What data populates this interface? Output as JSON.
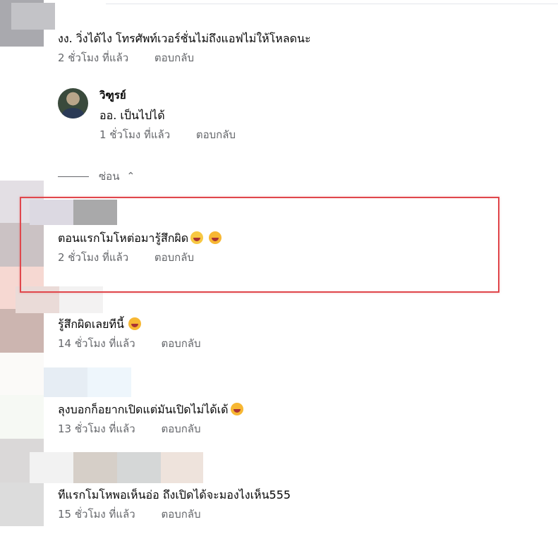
{
  "comments": [
    {
      "text": "งง. วิ่งได้ไง โทรศัพท์เวอร์ชั่นไม่ถึงแอฟไม่ให้โหลดนะ",
      "time": "2 ชั่วโมง ที่แล้ว",
      "reply": "ตอบกลับ"
    },
    {
      "text": "ตอนแรกโมโหต่อมารู้สึกผิด",
      "time": "2 ชั่วโมง ที่แล้ว",
      "reply": "ตอบกลับ"
    },
    {
      "text": "รู้สึกผิดเลยทีนี้",
      "time": "14 ชั่วโมง ที่แล้ว",
      "reply": "ตอบกลับ"
    },
    {
      "text": "ลุงบอกก็อยากเปิดแต่มันเปิดไม่ได้เด้",
      "time": "13 ชั่วโมง ที่แล้ว",
      "reply": "ตอบกลับ"
    },
    {
      "text": "ทีแรกโมโหพอเห็นอ่อ ถึงเปิดได้จะมองไงเห็น555",
      "time": "15 ชั่วโมง ที่แล้ว",
      "reply": "ตอบกลับ"
    }
  ],
  "reply": {
    "name": "วิฑูรย์",
    "text": "ออ. เป็นไปได้",
    "time": "1 ชั่วโมง ที่แล้ว",
    "reply": "ตอบกลับ"
  },
  "hide_label": "ซ่อน",
  "colors": {
    "highlight": "#e0474c",
    "meta": "#65676b"
  }
}
